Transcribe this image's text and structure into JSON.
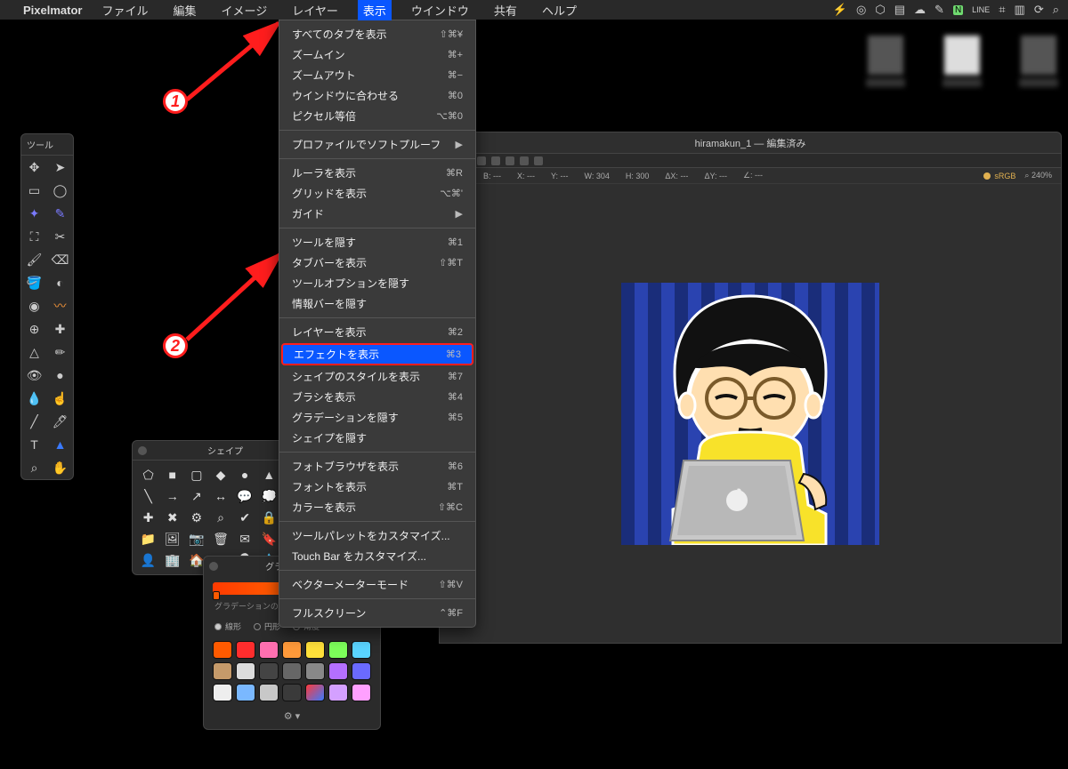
{
  "menubar": {
    "app": "Pixelmator",
    "items": [
      "ファイル",
      "編集",
      "イメージ",
      "レイヤー",
      "表示",
      "ウインドウ",
      "共有",
      "ヘルプ"
    ],
    "open_index": 4
  },
  "dropdown": {
    "groups": [
      [
        {
          "label": "すべてのタブを表示",
          "sc": "⇧⌘¥"
        },
        {
          "label": "ズームイン",
          "sc": "⌘+"
        },
        {
          "label": "ズームアウト",
          "sc": "⌘−"
        },
        {
          "label": "ウインドウに合わせる",
          "sc": "⌘0"
        },
        {
          "label": "ピクセル等倍",
          "sc": "⌥⌘0"
        }
      ],
      [
        {
          "label": "プロファイルでソフトプルーフ",
          "sc": "▶"
        }
      ],
      [
        {
          "label": "ルーラを表示",
          "sc": "⌘R"
        },
        {
          "label": "グリッドを表示",
          "sc": "⌥⌘'"
        },
        {
          "label": "ガイド",
          "sc": "▶"
        }
      ],
      [
        {
          "label": "ツールを隠す",
          "sc": "⌘1"
        },
        {
          "label": "タブバーを表示",
          "sc": "⇧⌘T"
        },
        {
          "label": "ツールオプションを隠す",
          "sc": ""
        },
        {
          "label": "情報バーを隠す",
          "sc": ""
        }
      ],
      [
        {
          "label": "レイヤーを表示",
          "sc": "⌘2"
        },
        {
          "label": "エフェクトを表示",
          "sc": "⌘3",
          "hl": true
        },
        {
          "label": "シェイプのスタイルを表示",
          "sc": "⌘7"
        },
        {
          "label": "ブラシを表示",
          "sc": "⌘4"
        },
        {
          "label": "グラデーションを隠す",
          "sc": "⌘5"
        },
        {
          "label": "シェイプを隠す",
          "sc": ""
        }
      ],
      [
        {
          "label": "フォトブラウザを表示",
          "sc": "⌘6"
        },
        {
          "label": "フォントを表示",
          "sc": "⌘T"
        },
        {
          "label": "カラーを表示",
          "sc": "⇧⌘C"
        }
      ],
      [
        {
          "label": "ツールパレットをカスタマイズ...",
          "sc": ""
        },
        {
          "label": "Touch Bar をカスタマイズ...",
          "sc": ""
        }
      ],
      [
        {
          "label": "ベクターメーターモード",
          "sc": "⇧⌘V"
        }
      ],
      [
        {
          "label": "フルスクリーン",
          "sc": "⌃⌘F"
        }
      ]
    ]
  },
  "tools": {
    "title": "ツール"
  },
  "shapes": {
    "title": "シェイプ"
  },
  "gradient": {
    "title": "グラデーション",
    "type_label": "グラデーションの種類",
    "opts": [
      "線形",
      "円形",
      "角度"
    ],
    "selected": 0,
    "swatches": [
      "#ff5a00",
      "#ff2d2d",
      "#ff6fb0",
      "#ff9a3a",
      "#ffe03a",
      "#7dff5a",
      "#5ad4ff",
      "#c59a6a",
      "#dcdcdc",
      "#444",
      "#666",
      "#888",
      "#b46fff",
      "#6a6aff",
      "#eee",
      "#7ab8ff",
      "#c8c8c8",
      "#3a3a3a",
      "linear-gradient(135deg,#ff3a3a,#3a7aff)",
      "#d4a0ff",
      "#ffa0ff"
    ]
  },
  "docwin": {
    "title": "hiramakun_1 — 編集済み",
    "info": {
      "W": "304",
      "H": "300",
      "deltaX": "",
      "deltaY": "",
      "angle": "",
      "srgb": "sRGB",
      "zoom": "240%"
    }
  },
  "annotations": {
    "badge1": "1",
    "badge2": "2"
  }
}
